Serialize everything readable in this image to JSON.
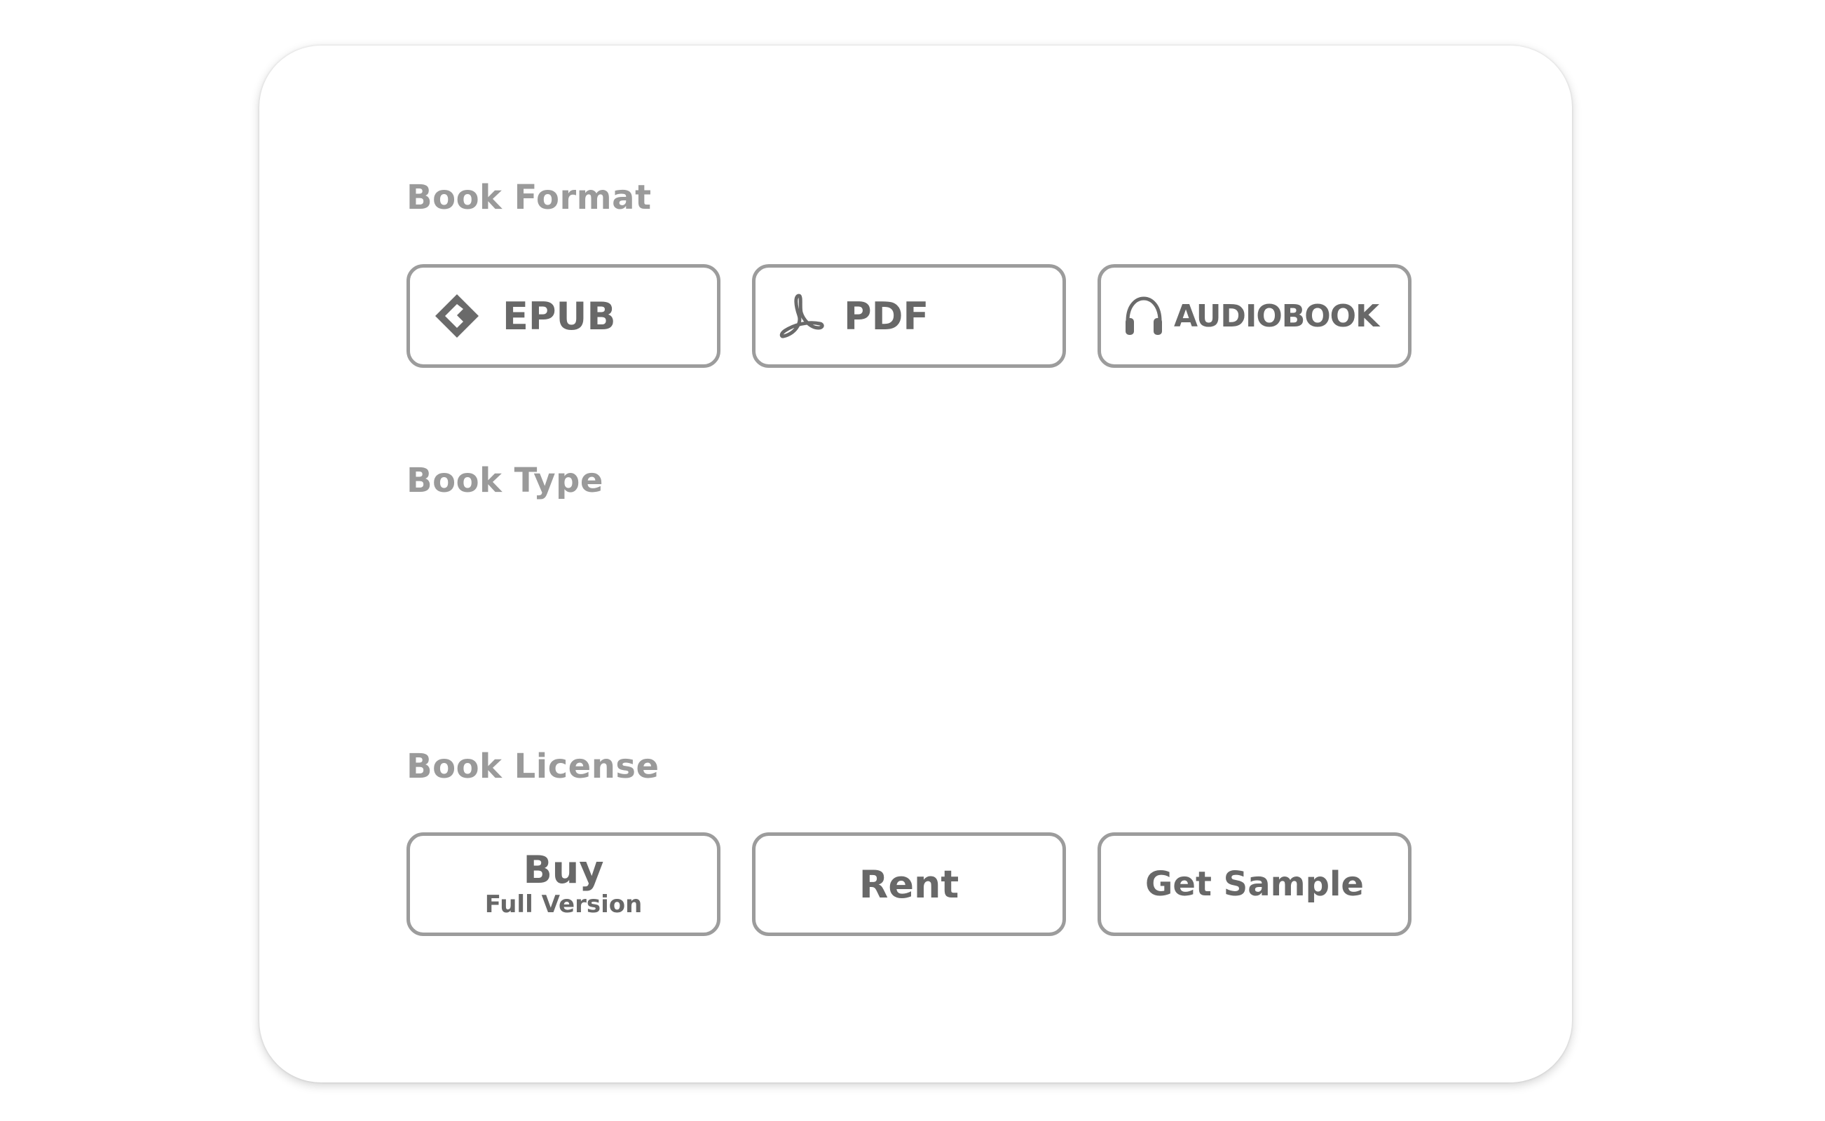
{
  "sections": {
    "format": {
      "title": "Book Format",
      "options": [
        {
          "label": "EPUB",
          "icon": "epub-icon"
        },
        {
          "label": "PDF",
          "icon": "pdf-icon"
        },
        {
          "label": "AUDIOBOOK",
          "icon": "headphones-icon"
        }
      ]
    },
    "type": {
      "title": "Book Type"
    },
    "license": {
      "title": "Book License",
      "options": [
        {
          "label": "Buy",
          "sublabel": "Full Version"
        },
        {
          "label": "Rent"
        },
        {
          "label": "Get Sample"
        }
      ]
    }
  },
  "colors": {
    "border": "#9c9c9c",
    "label_text": "#9a9a9a",
    "button_text": "#686868",
    "background": "#ffffff"
  }
}
